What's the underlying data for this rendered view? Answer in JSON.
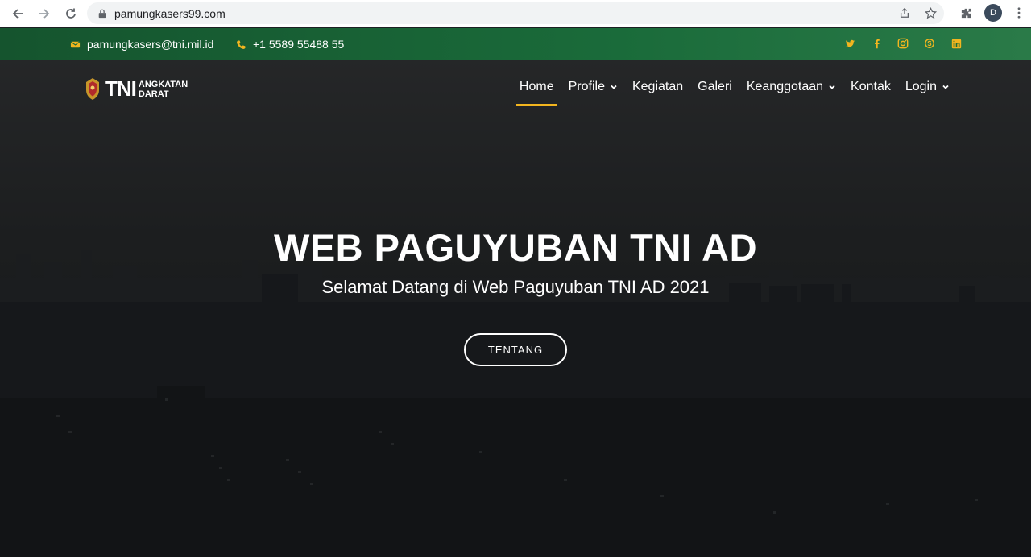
{
  "browser": {
    "url": "pamungkasers99.com",
    "profile_initial": "D",
    "icons": [
      "back-icon",
      "forward-icon",
      "reload-icon",
      "lock-icon",
      "share-icon",
      "star-icon",
      "extensions-icon",
      "menu-kebab-icon"
    ]
  },
  "topbar": {
    "email": "pamungkasers@tni.mil.id",
    "phone": "+1 5589 55488 55",
    "social_icons": [
      "twitter-icon",
      "facebook-icon",
      "instagram-icon",
      "skype-icon",
      "linkedin-icon"
    ]
  },
  "brand": {
    "logo_text": "TNI",
    "logo_sub_line1": "ANGKATAN",
    "logo_sub_line2": "DARAT"
  },
  "nav": {
    "items": [
      {
        "label": "Home",
        "active": true,
        "dropdown": false
      },
      {
        "label": "Profile",
        "active": false,
        "dropdown": true
      },
      {
        "label": "Kegiatan",
        "active": false,
        "dropdown": false
      },
      {
        "label": "Galeri",
        "active": false,
        "dropdown": false
      },
      {
        "label": "Keanggotaan",
        "active": false,
        "dropdown": true
      },
      {
        "label": "Kontak",
        "active": false,
        "dropdown": false
      },
      {
        "label": "Login",
        "active": false,
        "dropdown": true
      }
    ]
  },
  "hero": {
    "title": "WEB PAGUYUBAN TNI AD",
    "subtitle": "Selamat Datang di Web Paguyuban TNI AD 2021",
    "cta_label": "TENTANG"
  },
  "colors": {
    "topbar": "#1a6b3a",
    "accent": "#f2b51f",
    "hero_overlay": "#1d2023"
  }
}
